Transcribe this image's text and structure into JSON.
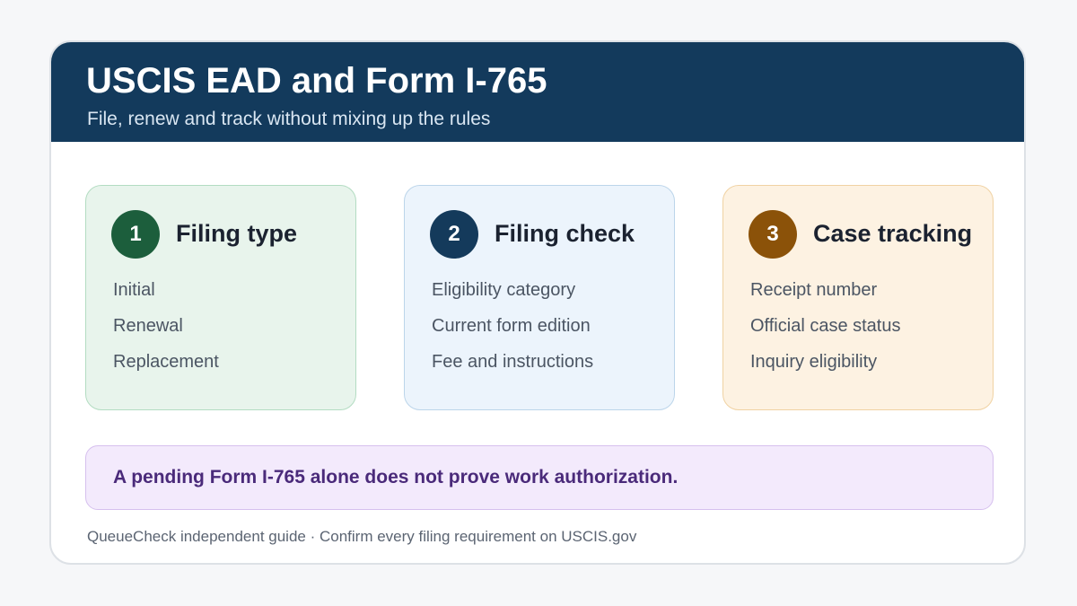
{
  "header": {
    "title": "USCIS EAD and Form I-765",
    "subtitle": "File, renew and track without mixing up the rules"
  },
  "steps": [
    {
      "number": "1",
      "title": "Filing type",
      "items": [
        "Initial",
        "Renewal",
        "Replacement"
      ],
      "accent_color": "#1c5e3c"
    },
    {
      "number": "2",
      "title": "Filing check",
      "items": [
        "Eligibility category",
        "Current form edition",
        "Fee and instructions"
      ],
      "accent_color": "#143a5b"
    },
    {
      "number": "3",
      "title": "Case tracking",
      "items": [
        "Receipt number",
        "Official case status",
        "Inquiry eligibility"
      ],
      "accent_color": "#8b5209"
    }
  ],
  "notice": {
    "text": "A pending Form I-765 alone does not prove work authorization."
  },
  "footer": {
    "text": "QueueCheck independent guide · Confirm every filing requirement on USCIS.gov"
  },
  "colors": {
    "header_bg": "#133a5c",
    "notice_bg": "#f3eafc",
    "notice_text": "#4a2a7a"
  }
}
